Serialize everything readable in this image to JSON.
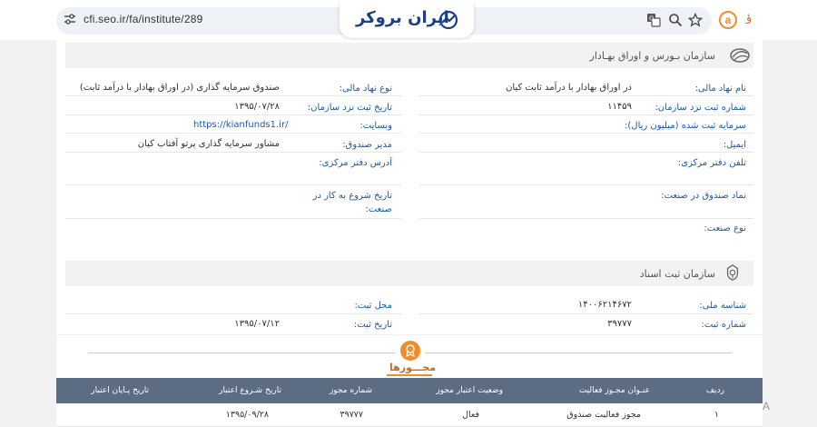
{
  "browser": {
    "url": "cfi.seo.ir/fa/institute/289",
    "logo_text": "ایران بروکر",
    "ext_label": "a",
    "ext2_label": "ؤ"
  },
  "section1": {
    "title": "سازمان بـورس و اوراق بهـادار",
    "right": [
      {
        "label": "نام نهاد مالی:",
        "value": "در اوراق بهادار با درآمد ثابت کیان"
      },
      {
        "label": "شماره ثبت نزد سازمان:",
        "value": "۱۱۴۵۹"
      },
      {
        "label": "سرمایه ثبت شده (میلیون ریال):",
        "value": ""
      },
      {
        "label": "ایمیل:",
        "value": ""
      },
      {
        "label": "تلفن دفتر مرکزی:",
        "value": ""
      },
      {
        "label": "نماد صندوق در صنعت:",
        "value": ""
      },
      {
        "label": "نوع صنعت:",
        "value": ""
      }
    ],
    "left": [
      {
        "label": "نوع نهاد مالی:",
        "value": "صندوق سرمایه گذاری (در اوراق بهادار با درآمد ثابت)"
      },
      {
        "label": "تاریخ ثبت نزد سازمان:",
        "value": "۱۳۹۵/۰۷/۲۸"
      },
      {
        "label": "وبسایت:",
        "value": "https://kianfunds1.ir/"
      },
      {
        "label": "مدیر صندوق:",
        "value": "مشاور سرمایه گذاری پرتو آفتاب کیان"
      },
      {
        "label": "آدرس دفتر مرکزی:",
        "value": ""
      },
      {
        "label1": "تاریخ شروع به کار در",
        "label2": "صنعت:",
        "value": ""
      }
    ]
  },
  "section2": {
    "title": "سازمان ثبت اسناد",
    "right": [
      {
        "label": "شناسه ملی:",
        "value": "۱۴۰۰۶۲۱۴۶۷۲"
      },
      {
        "label": "شماره ثبت:",
        "value": "۳۹۷۷۷"
      }
    ],
    "left": [
      {
        "label": "محل ثبت:",
        "value": ""
      },
      {
        "label": "تاریخ ثبت:",
        "value": "۱۳۹۵/۰۷/۱۲"
      }
    ]
  },
  "licenses": {
    "title": "مجـــوزها",
    "headers": [
      "ردیف",
      "عنـوان مجـوز فعالیت",
      "وضعیت اعتبار مجوز",
      "شماره مجوز",
      "تاریخ شـروع اعتبار",
      "تاریخ پـایان اعتبار"
    ],
    "rows": [
      [
        "۱",
        "مجوز فعالیت صندوق",
        "فعال",
        "۳۹۷۷۷",
        "۱۳۹۵/۰۹/۲۸",
        ""
      ]
    ]
  },
  "side_label": "A"
}
